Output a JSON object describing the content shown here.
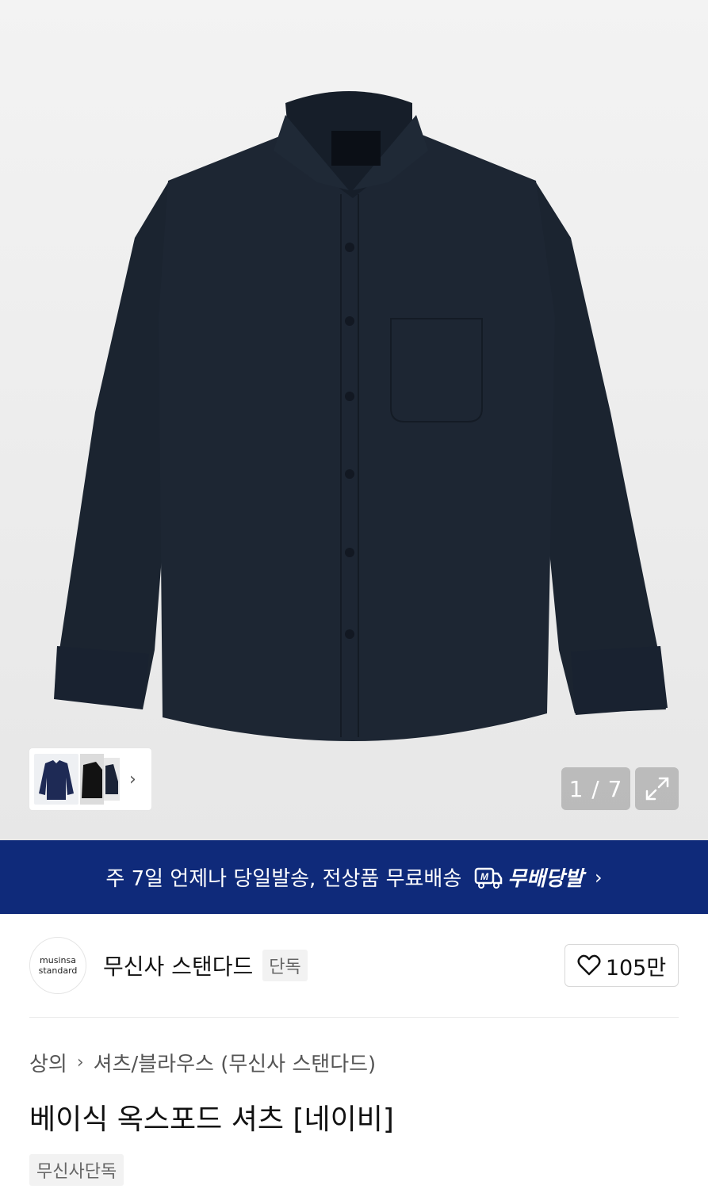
{
  "gallery": {
    "current": "1",
    "total": "7",
    "counter_separator": "/",
    "counter_text": "1 / 7",
    "shirt_color": "#1b2430"
  },
  "banner": {
    "text": "주 7일 언제나 당일발송, 전상품 무료배송",
    "brand_label": "무배당발",
    "bg_color": "#0f2a7a"
  },
  "brand": {
    "logo_line1": "musinsa",
    "logo_line2": "standard",
    "name": "무신사 스탠다드",
    "tag": "단독",
    "likes": "105만"
  },
  "breadcrumb": {
    "level1": "상의",
    "level2": "셔츠/블라우스 (무신사 스탠다드)"
  },
  "product": {
    "title": "베이식 옥스포드 셔츠 [네이비]",
    "badge": "무신사단독"
  }
}
